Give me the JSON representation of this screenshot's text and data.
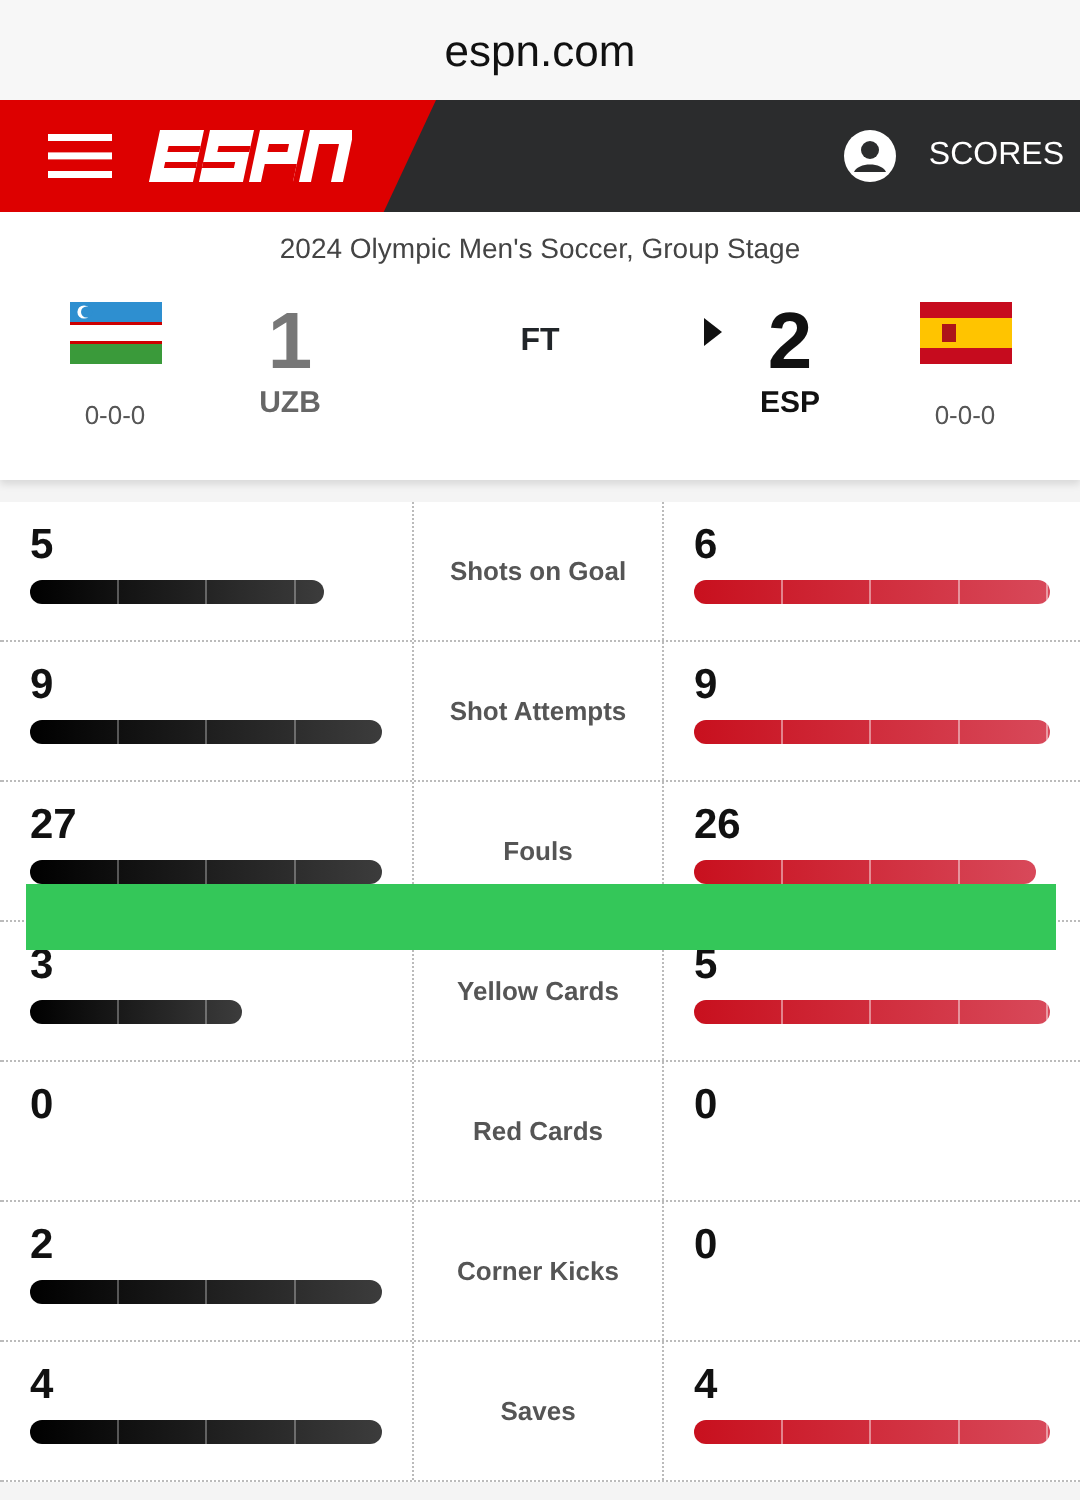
{
  "browser": {
    "address": "espn.com"
  },
  "header": {
    "nav_label": "SCORES"
  },
  "match": {
    "competition": "2024 Olympic Men's Soccer, Group Stage",
    "status": "FT",
    "teams": [
      {
        "abbr": "UZB",
        "score": "1",
        "record": "0-0-0",
        "winner": false
      },
      {
        "abbr": "ESP",
        "score": "2",
        "record": "0-0-0",
        "winner": true
      }
    ]
  },
  "stats": [
    {
      "label": "Shots on Goal",
      "home": {
        "value": "5"
      },
      "away": {
        "value": "6"
      }
    },
    {
      "label": "Shot Attempts",
      "home": {
        "value": "9"
      },
      "away": {
        "value": "9"
      }
    },
    {
      "label": "Fouls",
      "home": {
        "value": "27"
      },
      "away": {
        "value": "26"
      }
    },
    {
      "label": "Yellow Cards",
      "home": {
        "value": "3"
      },
      "away": {
        "value": "5"
      }
    },
    {
      "label": "Red Cards",
      "home": {
        "value": "0"
      },
      "away": {
        "value": "0"
      }
    },
    {
      "label": "Corner Kicks",
      "home": {
        "value": "2"
      },
      "away": {
        "value": "0"
      }
    },
    {
      "label": "Saves",
      "home": {
        "value": "4"
      },
      "away": {
        "value": "4"
      }
    }
  ]
}
